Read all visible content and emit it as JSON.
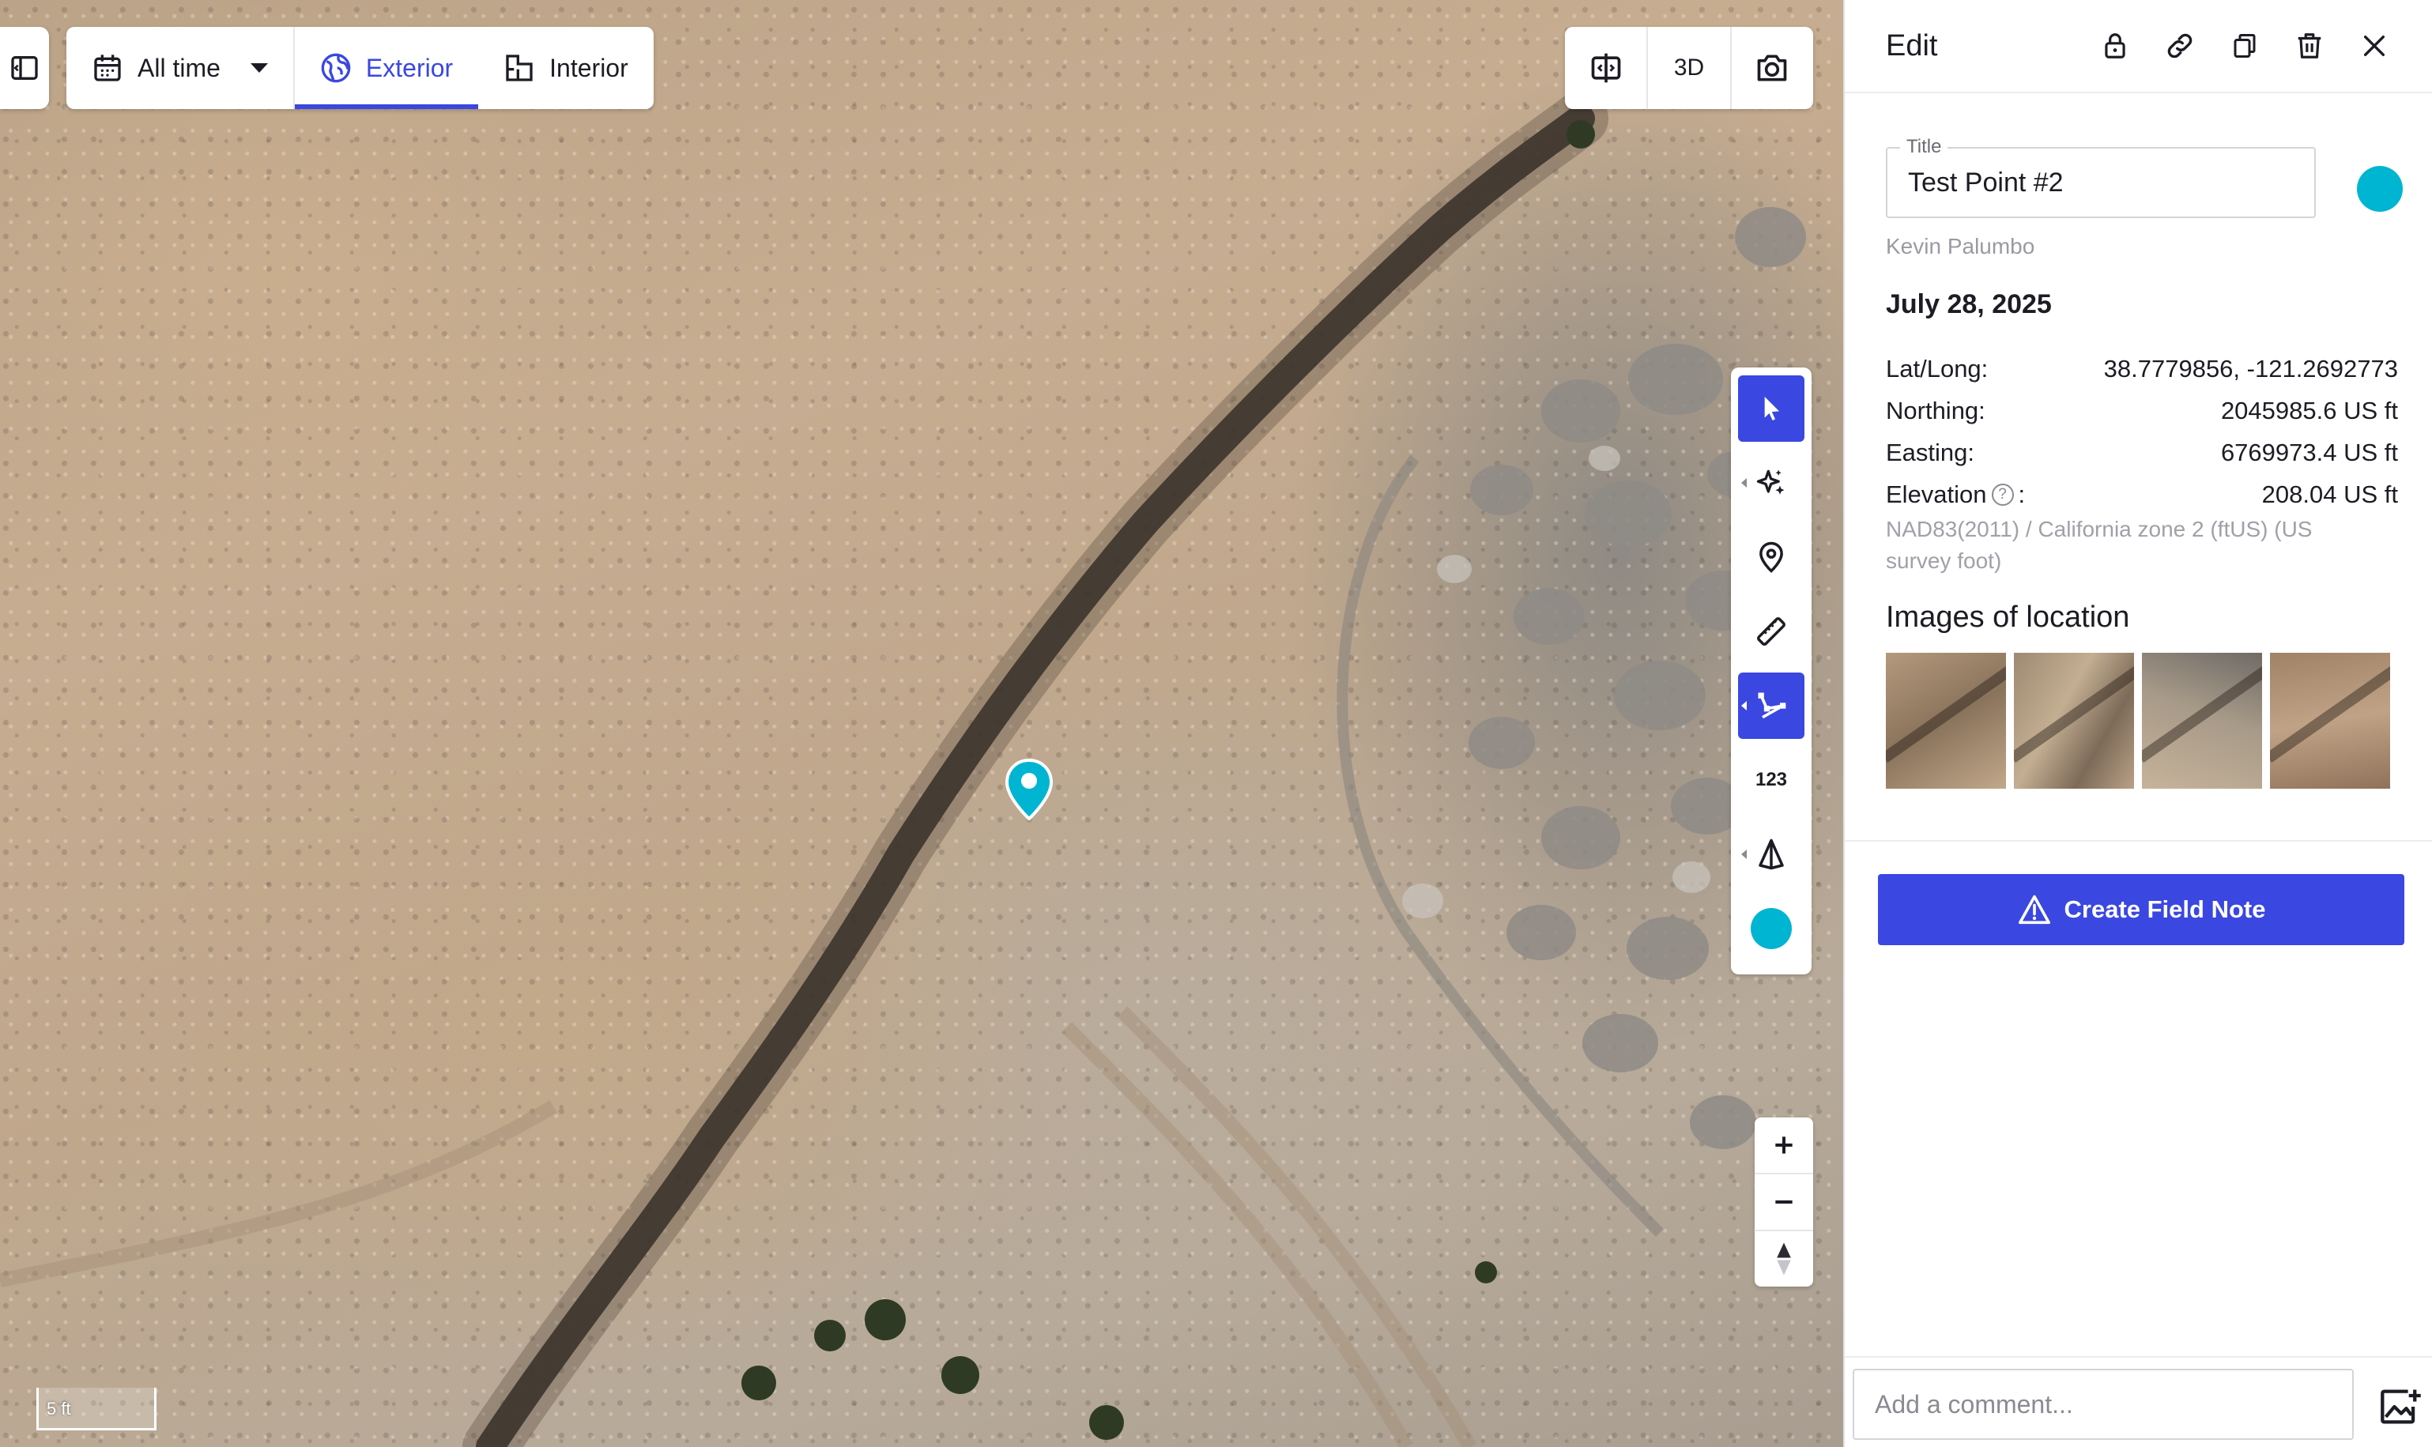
{
  "toolbar": {
    "time_filter": "All time",
    "tabs": [
      {
        "label": "Exterior",
        "active": true
      },
      {
        "label": "Interior",
        "active": false
      }
    ]
  },
  "map_controls": {
    "compare_icon": "split-view-icon",
    "mode_3d": "3D",
    "screenshot_icon": "camera-icon"
  },
  "palette": {
    "tools": [
      "select-pointer-icon",
      "ai-sparkle-icon",
      "location-pin-icon",
      "ruler-icon",
      "polyline-icon",
      "123",
      "triangle-icon",
      "color-swatch"
    ],
    "measure_label": "123",
    "selected": [
      "select-pointer-icon",
      "polyline-icon"
    ],
    "swatch_color": "#00b5d1"
  },
  "zoom": {
    "zoom_in_icon": "plus-icon",
    "zoom_out_icon": "minus-icon",
    "compass_icon": "compass-icon"
  },
  "scale_bar": {
    "label": "5 ft"
  },
  "panel": {
    "title": "Edit",
    "header_icons": [
      "lock-icon",
      "link-icon",
      "duplicate-icon",
      "trash-icon",
      "close-icon"
    ],
    "field_label": "Title",
    "field_value": "Test Point #2",
    "marker_color": "#00b5d1",
    "author": "Kevin Palumbo",
    "date": "July 28, 2025",
    "rows": [
      {
        "label": "Lat/Long:",
        "value": "38.7779856, -121.2692773"
      },
      {
        "label": "Northing:",
        "value": "2045985.6 US ft"
      },
      {
        "label": "Easting:",
        "value": "6769973.4 US ft"
      },
      {
        "label": "Elevation",
        "value": "208.04 US ft"
      }
    ],
    "elevation_suffix": ":",
    "crs": "NAD83(2011) / California zone 2 (ftUS) (US survey foot)",
    "images_title": "Images of location",
    "create_button": "Create Field Note",
    "comment_placeholder": "Add a comment..."
  },
  "colors": {
    "accent": "#3a47e0",
    "marker": "#00b5d1"
  }
}
